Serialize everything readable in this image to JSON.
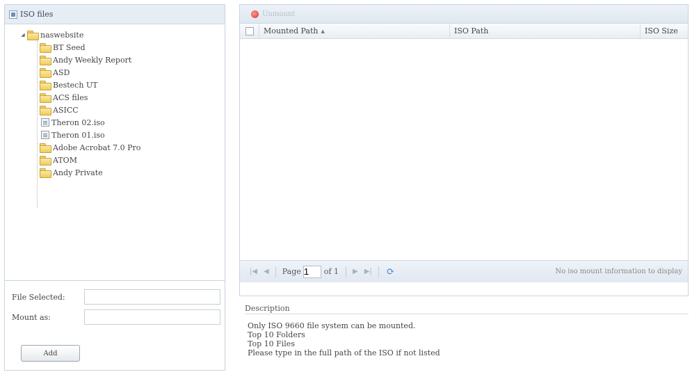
{
  "tree": {
    "header_label": "ISO files",
    "root": "naswebsite",
    "items": [
      {
        "label": "BT Seed",
        "type": "folder"
      },
      {
        "label": "Andy Weekly Report",
        "type": "folder"
      },
      {
        "label": "ASD",
        "type": "folder"
      },
      {
        "label": "Bestech UT",
        "type": "folder"
      },
      {
        "label": "ACS files",
        "type": "folder"
      },
      {
        "label": "ASICC",
        "type": "folder"
      },
      {
        "label": "Theron 02.iso",
        "type": "file"
      },
      {
        "label": "Theron 01.iso",
        "type": "file"
      },
      {
        "label": "Adobe Acrobat 7.0 Pro",
        "type": "folder"
      },
      {
        "label": "ATOM",
        "type": "folder"
      },
      {
        "label": "Andy Private",
        "type": "folder"
      }
    ]
  },
  "form": {
    "file_selected_label": "File Selected:",
    "file_selected_value": "",
    "mount_as_label": "Mount as:",
    "mount_as_value": "",
    "add_button": "Add"
  },
  "toolbar": {
    "unmount_label": "Unmount"
  },
  "grid": {
    "columns": [
      "Mounted Path",
      "ISO Path",
      "ISO Size"
    ],
    "rows": []
  },
  "pager": {
    "page_label": "Page",
    "page_value": "1",
    "of_label": "of 1",
    "info": "No iso mount information to display"
  },
  "description": {
    "title": "Description",
    "lines": [
      "Only ISO 9660 file system can be mounted.",
      "Top 10 Folders",
      "Top 10 Files",
      "Please type in the full path of the ISO if not listed"
    ]
  }
}
